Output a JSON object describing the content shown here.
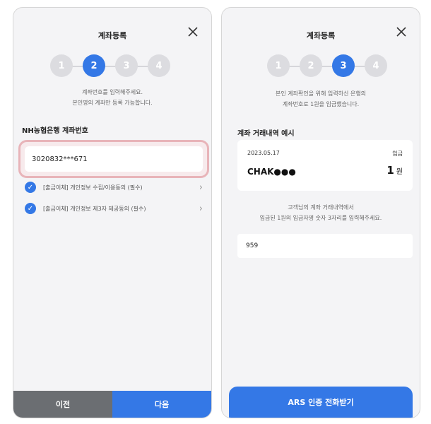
{
  "left": {
    "title": "계좌등록",
    "steps": [
      "1",
      "2",
      "3",
      "4"
    ],
    "active_step": 2,
    "guide_line1": "계좌번호를 입력해주세요.",
    "guide_line2": "본인명의 계좌만 등록 가능합니다.",
    "account_label": "NH농협은행 계좌번호",
    "account_value": "3020832***671",
    "agreements": [
      "[출금이체] 개인정보 수집/이용동의 (필수)",
      "[출금이체] 개인정보 제3자 제공동의 (필수)"
    ],
    "prev_button": "이전",
    "next_button": "다음"
  },
  "right": {
    "title": "계좌등록",
    "steps": [
      "1",
      "2",
      "3",
      "4"
    ],
    "active_step": 3,
    "guide_line1": "본인 계좌확인을 위해 입력하신 은행의",
    "guide_line2": "계좌번호로 1원을 입금했습니다.",
    "history_label": "계좌 거래내역 예시",
    "history": {
      "date": "2023.05.17",
      "type": "입금",
      "name": "CHAK●●●",
      "amount": "1",
      "unit": "원"
    },
    "instruction_line1": "고객님의 계좌 거래내역에서",
    "instruction_line2": "입금된 1원의 입금자명 숫자 3자리를 입력해주세요.",
    "code_value": "959",
    "ars_button": "ARS 인증 전화받기"
  },
  "colors": {
    "accent": "#3478e6",
    "step_inactive": "#dcdce0",
    "prev_button": "#6b6e72",
    "highlight_border": "#e8b4b9"
  },
  "icons": {
    "close": "close-icon",
    "check": "check-icon",
    "chevron": "chevron-right-icon"
  }
}
